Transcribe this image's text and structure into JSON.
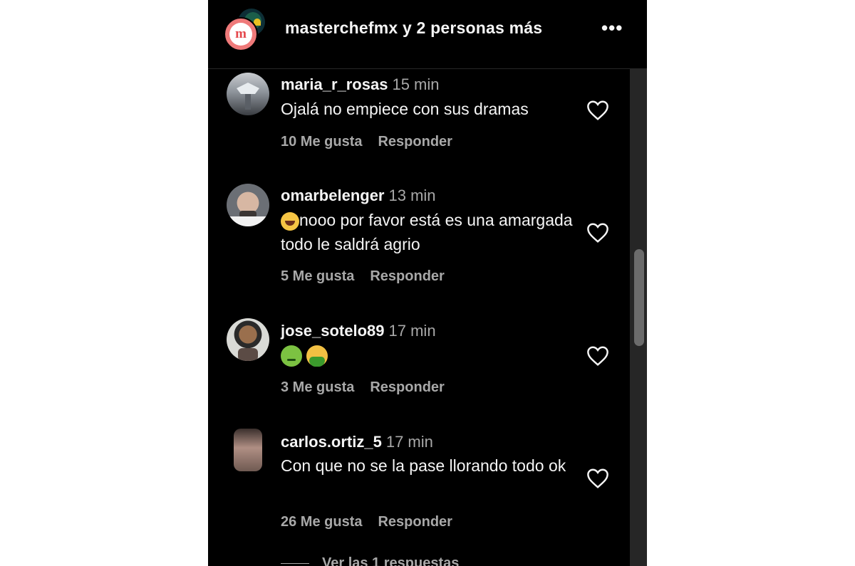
{
  "header": {
    "title": "masterchefmx y 2 personas más",
    "more_label": "•••",
    "logo_letter": "m"
  },
  "comments": [
    {
      "username": "maria_r_rosas",
      "time": "15 min",
      "text": "Ojalá no empiece con sus dramas",
      "likes": "10 Me gusta",
      "reply": "Responder"
    },
    {
      "username": "omarbelenger",
      "time": "13 min",
      "emoji": "face-with-tears-of-joy",
      "text": "nooo por favor está es una amargada todo le saldrá agrio",
      "likes": "5 Me gusta",
      "reply": "Responder"
    },
    {
      "username": "jose_sotelo89",
      "time": "17 min",
      "emojis": [
        "nauseated-face",
        "vomiting-face"
      ],
      "likes": "3 Me gusta",
      "reply": "Responder"
    },
    {
      "username": "carlos.ortiz_5",
      "time": "17 min",
      "text": "Con que no se la pase llorando todo ok",
      "likes": "26 Me gusta",
      "reply": "Responder"
    }
  ],
  "view_replies": "Ver las 1 respuestas",
  "colors": {
    "background": "#000000",
    "text": "#f5f5f5",
    "secondary_text": "#a8a8a8",
    "scrollbar_track": "#262626",
    "scrollbar_thumb": "#6b6b6b"
  }
}
